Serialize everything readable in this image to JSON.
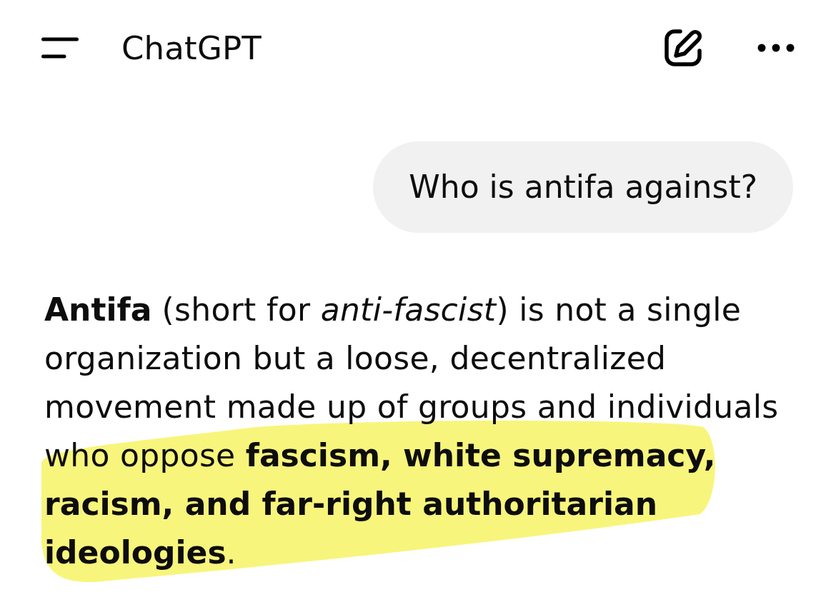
{
  "header": {
    "title": "ChatGPT"
  },
  "messages": [
    {
      "kind": "user",
      "text": "Who is antifa against?",
      "highlighted": false
    },
    {
      "kind": "assistant",
      "text": "**Antifa** (short for *anti-fascist*) is not a single organization but a loose, decentralized movement made up of groups and individuals who oppose **fascism, white supremacy, racism, and far-right authoritarian ideologies**.",
      "highlighted": true
    }
  ]
}
